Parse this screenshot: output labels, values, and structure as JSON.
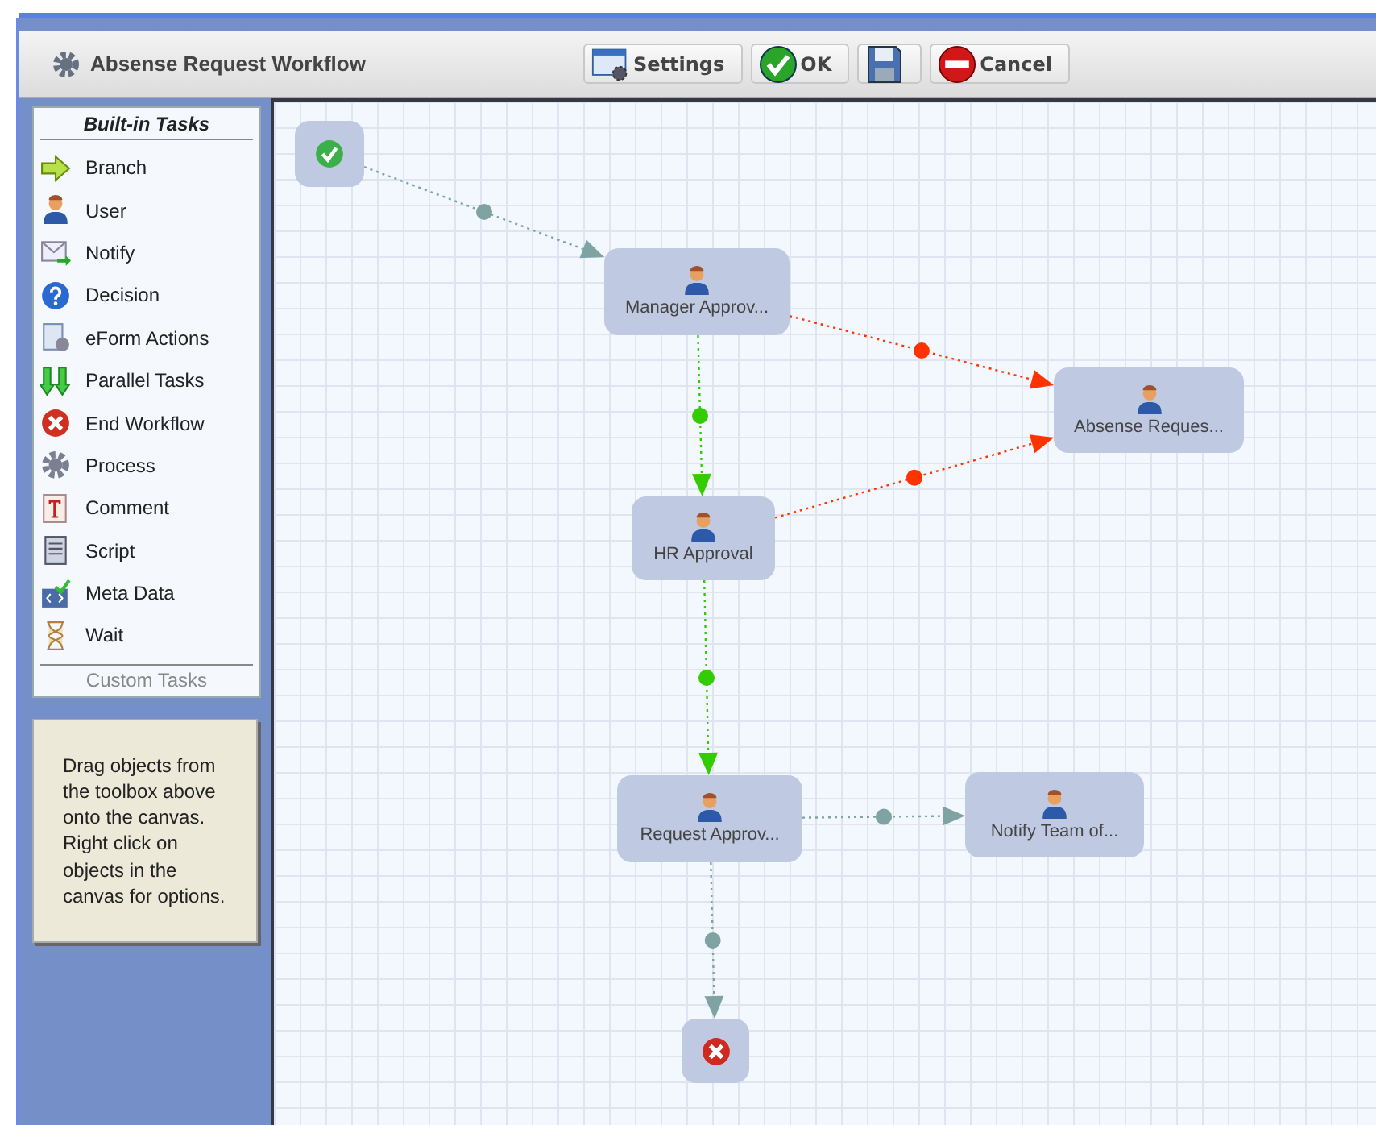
{
  "window": {
    "title": "Absense Request Workflow"
  },
  "toolbar": [
    {
      "kind": "settings",
      "label": "Settings"
    },
    {
      "kind": "ok",
      "label": "OK"
    },
    {
      "kind": "save"
    },
    {
      "kind": "cancel",
      "label": "Cancel"
    }
  ],
  "toolbox": {
    "title": "Built-in Tasks",
    "items": [
      {
        "kind": "branch",
        "label": "Branch"
      },
      {
        "kind": "user",
        "label": "User"
      },
      {
        "kind": "notify",
        "label": "Notify"
      },
      {
        "kind": "decision",
        "label": "Decision"
      },
      {
        "kind": "eform",
        "label": "eForm Actions"
      },
      {
        "kind": "parallel",
        "label": "Parallel Tasks"
      },
      {
        "kind": "end",
        "label": "End Workflow"
      },
      {
        "kind": "process",
        "label": "Process"
      },
      {
        "kind": "comment",
        "label": "Comment"
      },
      {
        "kind": "script",
        "label": "Script"
      },
      {
        "kind": "meta",
        "label": "Meta Data"
      },
      {
        "kind": "wait",
        "label": "Wait"
      }
    ],
    "footer": "Custom Tasks"
  },
  "hint": "Drag objects from the toolbox above onto the canvas. Right click on objects in the canvas for options.",
  "canvas": {
    "nodes": [
      {
        "kind": "start"
      },
      {
        "kind": "user",
        "label": "Manager Approv..."
      },
      {
        "kind": "user",
        "label": "Absense Reques..."
      },
      {
        "kind": "user",
        "label": "HR Approval"
      },
      {
        "kind": "user",
        "label": "Request Approv..."
      },
      {
        "kind": "user",
        "label": "Notify Team of..."
      },
      {
        "kind": "end"
      }
    ],
    "edges": [
      {
        "color": "#7fa3a3"
      },
      {
        "color": "#ff3300"
      },
      {
        "color": "#33cc00"
      },
      {
        "color": "#ff3300"
      },
      {
        "color": "#33cc00"
      },
      {
        "color": "#7fa3a3"
      },
      {
        "color": "#7fa3a3"
      }
    ]
  }
}
